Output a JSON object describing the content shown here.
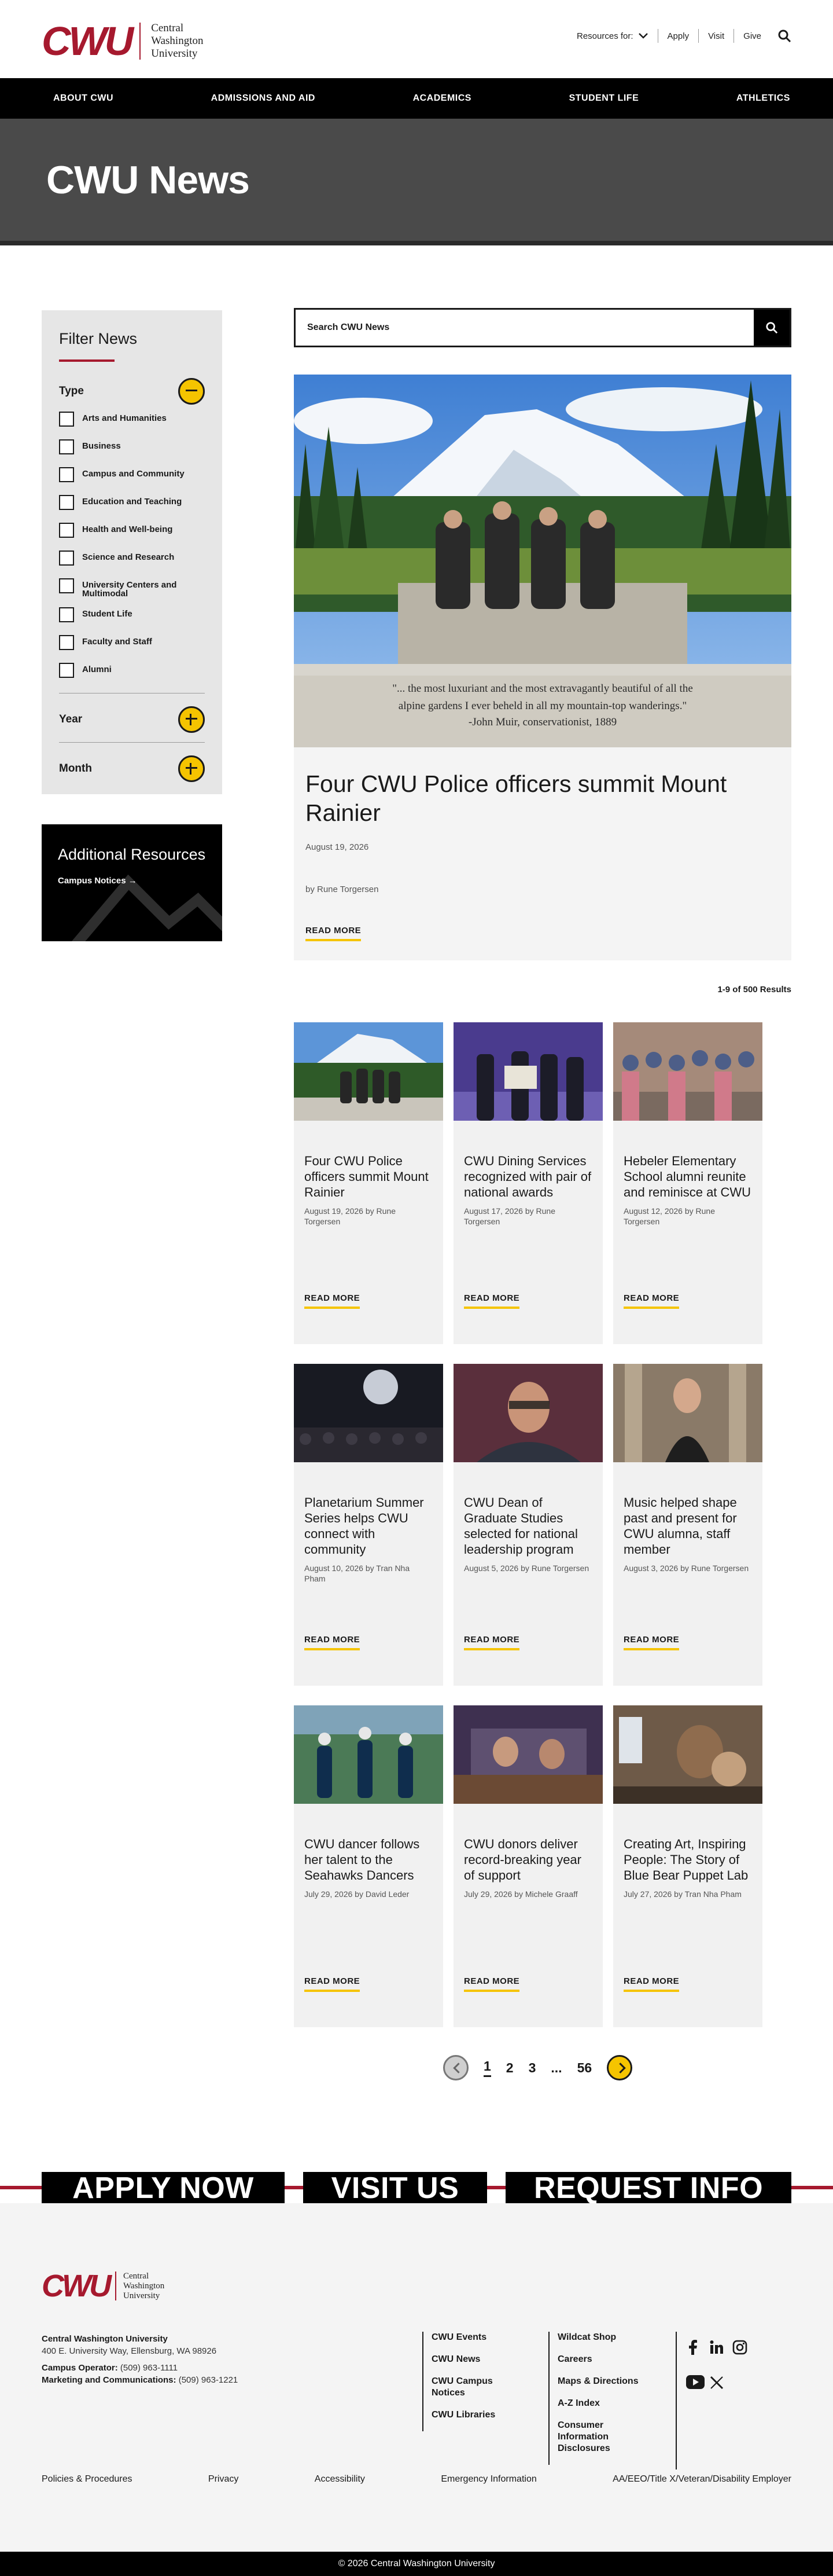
{
  "brand": {
    "logo_text": "CWU",
    "name_lines": [
      "Central",
      "Washington",
      "University"
    ],
    "colors": {
      "crimson": "#a6192e",
      "gold": "#f5c400",
      "black": "#000000",
      "hero_gray": "#4a4a4a"
    }
  },
  "utility": {
    "resources_label": "Resources for:",
    "links": [
      "Apply",
      "Visit",
      "Give"
    ],
    "search_icon": "search-icon"
  },
  "nav": [
    "ABOUT CWU",
    "ADMISSIONS AND AID",
    "ACADEMICS",
    "STUDENT LIFE",
    "ATHLETICS"
  ],
  "hero": {
    "title": "CWU News"
  },
  "filter": {
    "title": "Filter News",
    "type_label": "Type",
    "types": [
      "Arts and Humanities",
      "Business",
      "Campus and Community",
      "Education and Teaching",
      "Health and Well-being",
      "Science and Research",
      "University Centers and Multimodal",
      "Student Life",
      "Faculty and Staff",
      "Alumni"
    ],
    "year_label": "Year",
    "month_label": "Month"
  },
  "resources": {
    "title": "Additional Resources",
    "link": "Campus Notices →"
  },
  "search": {
    "placeholder": "Search CWU News"
  },
  "featured": {
    "quote_lines": [
      "\"... the most luxuriant and the most extravagantly beautiful of all the",
      "alpine gardens I ever beheld in all my mountain-top wanderings.\"",
      "-John Muir, conservationist, 1889"
    ],
    "title": "Four CWU Police officers summit Mount Rainier",
    "date": "August 19, 2026",
    "byline": "by Rune Torgersen",
    "read_more": "READ MORE"
  },
  "results_count": "1-9 of 500 Results",
  "cards": [
    {
      "title": "Four CWU Police officers summit Mount Rainier",
      "meta": "August 19, 2026 by Rune Torgersen",
      "read_more": "READ MORE"
    },
    {
      "title": "CWU Dining Services recognized with pair of national awards",
      "meta": "August 17, 2026 by Rune Torgersen",
      "read_more": "READ MORE"
    },
    {
      "title": "Hebeler Elementary School alumni reunite and reminisce at CWU",
      "meta": "August 12, 2026 by Rune Torgersen",
      "read_more": "READ MORE"
    },
    {
      "title": "Planetarium Summer Series helps CWU connect with community",
      "meta": "August 10, 2026 by Tran Nha Pham",
      "read_more": "READ MORE"
    },
    {
      "title": "CWU Dean of Graduate Studies selected for national leadership program",
      "meta": "August 5, 2026 by Rune Torgersen",
      "read_more": "READ MORE"
    },
    {
      "title": "Music helped shape past and present for CWU alumna, staff member",
      "meta": "August 3, 2026 by Rune Torgersen",
      "read_more": "READ MORE"
    },
    {
      "title": "CWU dancer follows her talent to the Seahawks Dancers",
      "meta": "July 29, 2026 by David Leder",
      "read_more": "READ MORE"
    },
    {
      "title": "CWU donors deliver record-breaking year of support",
      "meta": "July 29, 2026 by Michele Graaff",
      "read_more": "READ MORE"
    },
    {
      "title": "Creating Art, Inspiring People: The Story of Blue Bear Puppet Lab",
      "meta": "July 27, 2026 by Tran Nha Pham",
      "read_more": "READ MORE"
    }
  ],
  "pagination": {
    "pages": [
      "1",
      "2",
      "3",
      "...",
      "56"
    ],
    "current": "1"
  },
  "cta": [
    "APPLY NOW",
    "VISIT US",
    "REQUEST INFO"
  ],
  "footer": {
    "org": "Central Washington University",
    "address": "400 E. University Way, Ellensburg, WA 98926",
    "operator_label": "Campus Operator:",
    "operator_phone": "(509) 963-1111",
    "marketing_label": "Marketing and Communications:",
    "marketing_phone": "(509) 963-1221",
    "col1": [
      "CWU Events",
      "CWU News",
      "CWU Campus Notices",
      "CWU Libraries"
    ],
    "col2": [
      "Wildcat Shop",
      "Careers",
      "Maps & Directions",
      "A-Z Index",
      "Consumer Information Disclosures"
    ],
    "social": [
      "facebook-icon",
      "linkedin-icon",
      "instagram-icon",
      "youtube-icon",
      "x-icon"
    ],
    "bottom_links": [
      "Policies & Procedures",
      "Privacy",
      "Accessibility",
      "Emergency Information",
      "AA/EEO/Title X/Veteran/Disability Employer"
    ],
    "copyright": "© 2026 Central Washington University"
  }
}
